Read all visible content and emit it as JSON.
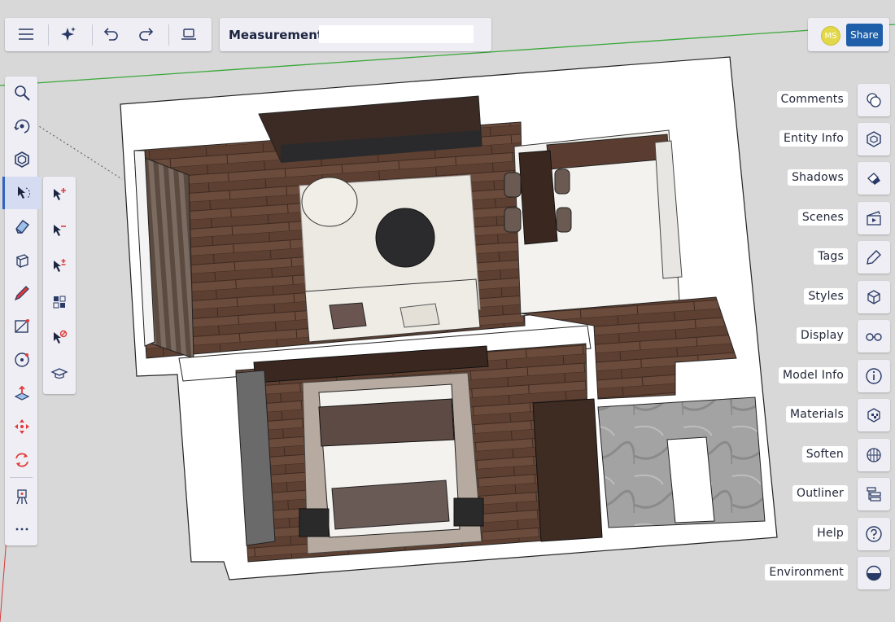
{
  "toolbar": {
    "menu_icon": "hamburger-icon",
    "ai_icon": "sparkle-icon",
    "undo_icon": "undo-icon",
    "redo_icon": "redo-icon",
    "display_icon": "laptop-icon"
  },
  "document": {
    "title": "Measurements",
    "title_field_value": ""
  },
  "user": {
    "initials": "MS",
    "avatar_color": "#e2d84a",
    "share_label": "Share",
    "share_color": "#1f5ea8"
  },
  "tools": [
    {
      "name": "search",
      "icon": "search-icon"
    },
    {
      "name": "orbit",
      "icon": "orbit-icon"
    },
    {
      "name": "components",
      "icon": "components-icon"
    },
    {
      "name": "select",
      "icon": "select-icon",
      "active": true
    },
    {
      "name": "eraser",
      "icon": "eraser-icon"
    },
    {
      "name": "push-pull",
      "icon": "push-pull-icon"
    },
    {
      "name": "pencil",
      "icon": "pencil-icon"
    },
    {
      "name": "rectangle",
      "icon": "rectangle-icon"
    },
    {
      "name": "circle",
      "icon": "circle-icon"
    },
    {
      "name": "extrude",
      "icon": "extrude-icon"
    },
    {
      "name": "move",
      "icon": "move-icon"
    },
    {
      "name": "rotate",
      "icon": "rotate-icon"
    },
    {
      "name": "scene",
      "icon": "easel-icon"
    },
    {
      "name": "more",
      "icon": "more-icon"
    }
  ],
  "select_subtools": [
    {
      "name": "add-to-selection",
      "icon": "select-add-icon"
    },
    {
      "name": "subtract-from-selection",
      "icon": "select-subtract-icon"
    },
    {
      "name": "toggle-selection",
      "icon": "select-toggle-icon"
    },
    {
      "name": "select-all",
      "icon": "select-all-icon"
    },
    {
      "name": "select-none",
      "icon": "select-none-icon"
    },
    {
      "name": "instructor",
      "icon": "graduation-cap-icon"
    }
  ],
  "right_panels": [
    {
      "label": "Comments",
      "icon": "comments-icon"
    },
    {
      "label": "Entity Info",
      "icon": "entity-info-icon"
    },
    {
      "label": "Shadows",
      "icon": "shadows-icon"
    },
    {
      "label": "Scenes",
      "icon": "scenes-icon"
    },
    {
      "label": "Tags",
      "icon": "tags-icon"
    },
    {
      "label": "Styles",
      "icon": "styles-icon"
    },
    {
      "label": "Display",
      "icon": "glasses-icon"
    },
    {
      "label": "Model Info",
      "icon": "info-icon"
    },
    {
      "label": "Materials",
      "icon": "materials-icon"
    },
    {
      "label": "Soften",
      "icon": "soften-icon"
    },
    {
      "label": "Outliner",
      "icon": "outliner-icon"
    },
    {
      "label": "Help",
      "icon": "help-icon"
    },
    {
      "label": "Environment",
      "icon": "environment-icon"
    }
  ],
  "colors": {
    "accent": "#2f62c3",
    "icon": "#2a3a66",
    "icon_red": "#e23a3a",
    "axis_green": "#3aa83a",
    "wall": "#ffffff",
    "floor_wood": "#6a4a3a",
    "rug": "#ece8e2",
    "floor_light": "#f4f2ee",
    "tile": "#a6a6a6"
  }
}
